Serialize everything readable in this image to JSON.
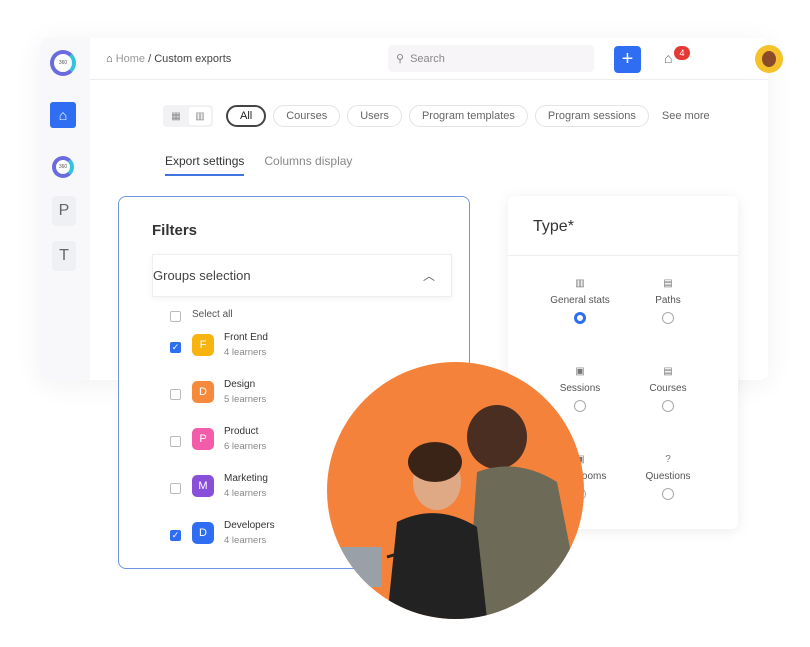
{
  "sidebar": {
    "logo_text": "360",
    "letters": [
      "P",
      "T"
    ]
  },
  "header": {
    "breadcrumb_home": "Home",
    "breadcrumb_sep": " / ",
    "breadcrumb_current": "Custom exports",
    "search_placeholder": "Search",
    "notifications_count": "4"
  },
  "filters_bar": {
    "chips": [
      "All",
      "Courses",
      "Users",
      "Program templates",
      "Program sessions"
    ],
    "see_more": "See more"
  },
  "tabs": [
    "Export settings",
    "Columns display"
  ],
  "filters": {
    "title": "Filters",
    "groups_title": "Groups selection",
    "select_all": "Select all",
    "groups": [
      {
        "initial": "F",
        "name": "Front End",
        "learners": "4 learners",
        "checked": true,
        "color": "#f7b40f"
      },
      {
        "initial": "D",
        "name": "Design",
        "learners": "5 learners",
        "checked": false,
        "color": "#f58a3c"
      },
      {
        "initial": "P",
        "name": "Product",
        "learners": "6 learners",
        "checked": false,
        "color": "#f25ca8"
      },
      {
        "initial": "M",
        "name": "Marketing",
        "learners": "4 learners",
        "checked": false,
        "color": "#8a4fd8"
      },
      {
        "initial": "D",
        "name": "Developers",
        "learners": "4 learners",
        "checked": true,
        "color": "#2f6ef2"
      }
    ]
  },
  "type": {
    "title": "Type*",
    "options": [
      {
        "label": "General stats",
        "icon": "bar-chart-icon",
        "selected": true
      },
      {
        "label": "Paths",
        "icon": "document-icon",
        "selected": false
      },
      {
        "label": "Sessions",
        "icon": "video-icon",
        "selected": false
      },
      {
        "label": "Courses",
        "icon": "document-icon",
        "selected": false
      },
      {
        "label": "Classrooms",
        "icon": "classroom-icon",
        "selected": false
      },
      {
        "label": "Questions",
        "icon": "question-icon",
        "selected": false
      }
    ]
  },
  "colors": {
    "accent": "#2f6ef2",
    "photo_bg": "#f5823a"
  }
}
